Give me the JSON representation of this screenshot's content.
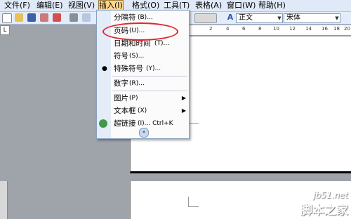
{
  "menubar": {
    "items": [
      "文件(F)",
      "编辑(E)",
      "视图(V)",
      "插入(I)",
      "格式(O)",
      "工具(T)",
      "表格(A)",
      "窗口(W)",
      "帮助(H)"
    ]
  },
  "toolbar": {
    "style_value": "正文",
    "font_value": "宋体",
    "style_icon": "A"
  },
  "ruler": {
    "ticks": [
      "2",
      "4",
      "6",
      "8",
      "10",
      "12",
      "14",
      "16",
      "18",
      "20"
    ],
    "corner": "L"
  },
  "insert_menu": {
    "items": [
      {
        "label": "分隔符",
        "short": "(B)..."
      },
      {
        "label": "页码",
        "short": "(U)..."
      },
      {
        "label": "日期和时间",
        "short": "(T)..."
      },
      {
        "label": "符号",
        "short": "(S)..."
      },
      {
        "label": "特殊符号",
        "short": "(Y)..."
      },
      {
        "label": "数字",
        "short": "(R)..."
      },
      {
        "label": "图片",
        "short": "(P)"
      },
      {
        "label": "文本框",
        "short": "(X)"
      },
      {
        "label": "超链接",
        "short": "(I)...   Ctrl+K"
      }
    ],
    "submenu_arrow": "▶",
    "expand": "»"
  },
  "watermark": {
    "site": "jb51.net",
    "name": "脚本之家"
  },
  "colors": {
    "highlight": "#e0252a",
    "menubar_bg": "#dfe9f7",
    "active_menu": "#ffd88d"
  }
}
